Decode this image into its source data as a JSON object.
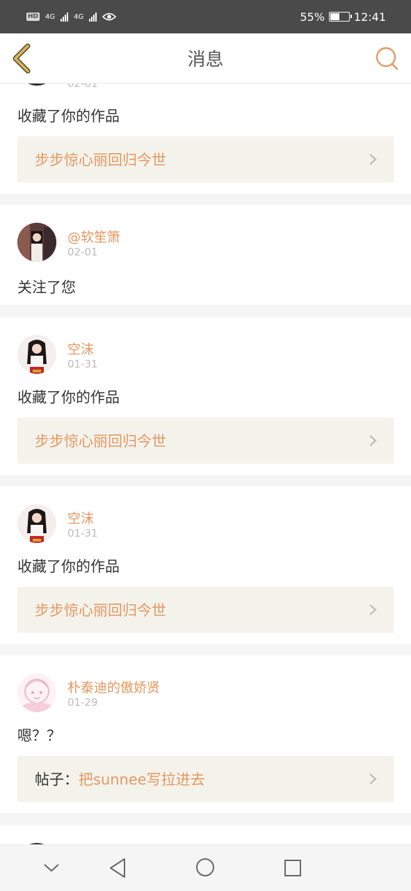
{
  "status_bar": {
    "battery": "55%",
    "time": "12:41",
    "network_a": "4G",
    "network_b": "4G",
    "hd": "HD",
    "battery_level": 0.55
  },
  "header": {
    "title": "消息"
  },
  "messages": [
    {
      "name": "",
      "date": "02-01",
      "action": "收藏了你的作品",
      "link_prefix": "",
      "link_text": "步步惊心丽回归今世"
    },
    {
      "name": "@软笙箫",
      "date": "02-01",
      "action": "关注了您"
    },
    {
      "name": "空沫",
      "date": "01-31",
      "action": "收藏了你的作品",
      "link_prefix": "",
      "link_text": "步步惊心丽回归今世"
    },
    {
      "name": "空沫",
      "date": "01-31",
      "action": "收藏了你的作品",
      "link_prefix": "",
      "link_text": "步步惊心丽回归今世"
    },
    {
      "name": "朴泰迪的傲娇贤",
      "date": "01-29",
      "action": "嗯？？",
      "link_prefix": "帖子：",
      "link_text": "把sunnee写拉进去"
    }
  ],
  "colors": {
    "accent": "#e6975f",
    "back_arrow": "#d9b25a",
    "status_bar_bg": "#4a4a4a",
    "link_box_bg": "#f3f3ec"
  },
  "icons": {
    "back": "chevron-left-icon",
    "search": "search-icon",
    "link_arrow": "chevron-right-icon"
  }
}
